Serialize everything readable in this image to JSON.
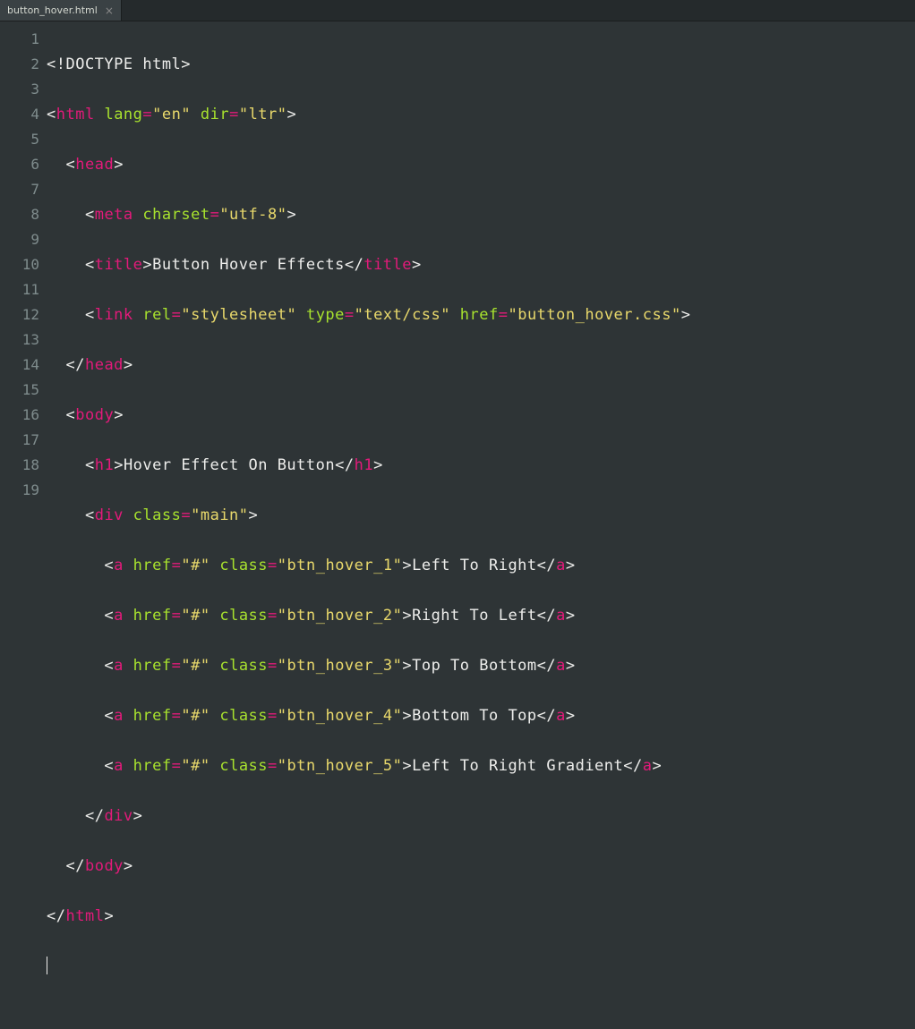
{
  "tab": {
    "title": "button_hover.html",
    "close": "×"
  },
  "gutter": [
    "1",
    "2",
    "3",
    "4",
    "5",
    "6",
    "7",
    "8",
    "9",
    "10",
    "11",
    "12",
    "13",
    "14",
    "15",
    "16",
    "17",
    "18",
    "19"
  ],
  "code": {
    "l1": {
      "doctype": "<!DOCTYPE html>"
    },
    "l2": {
      "o": "<",
      "tag": "html",
      "sp": " ",
      "a1": "lang",
      "eq": "=",
      "v1": "\"en\"",
      "sp2": " ",
      "a2": "dir",
      "v2": "\"ltr\"",
      "c": ">"
    },
    "l3": {
      "ind": "  ",
      "o": "<",
      "tag": "head",
      "c": ">"
    },
    "l4": {
      "ind": "    ",
      "o": "<",
      "tag": "meta",
      "sp": " ",
      "a1": "charset",
      "eq": "=",
      "v1": "\"utf-8\"",
      "c": ">"
    },
    "l5": {
      "ind": "    ",
      "o": "<",
      "tag": "title",
      "c": ">",
      "txt": "Button Hover Effects",
      "o2": "</",
      "c2": ">"
    },
    "l6": {
      "ind": "    ",
      "o": "<",
      "tag": "link",
      "sp": " ",
      "a1": "rel",
      "eq": "=",
      "v1": "\"stylesheet\"",
      "sp2": " ",
      "a2": "type",
      "v2": "\"text/css\"",
      "sp3": " ",
      "a3": "href",
      "v3": "\"button_hover.css\"",
      "c": ">"
    },
    "l7": {
      "ind": "  ",
      "o": "</",
      "tag": "head",
      "c": ">"
    },
    "l8": {
      "ind": "  ",
      "o": "<",
      "tag": "body",
      "c": ">"
    },
    "l9": {
      "ind": "    ",
      "o": "<",
      "tag": "h1",
      "c": ">",
      "txt": "Hover Effect On Button",
      "o2": "</",
      "c2": ">"
    },
    "l10": {
      "ind": "    ",
      "o": "<",
      "tag": "div",
      "sp": " ",
      "a1": "class",
      "eq": "=",
      "v1": "\"main\"",
      "c": ">"
    },
    "l11": {
      "ind": "      ",
      "o": "<",
      "tag": "a",
      "sp": " ",
      "a1": "href",
      "eq": "=",
      "v1": "\"#\"",
      "sp2": " ",
      "a2": "class",
      "v2": "\"btn_hover_1\"",
      "c": ">",
      "txt": "Left To Right",
      "o2": "</",
      "c2": ">"
    },
    "l12": {
      "ind": "      ",
      "o": "<",
      "tag": "a",
      "sp": " ",
      "a1": "href",
      "eq": "=",
      "v1": "\"#\"",
      "sp2": " ",
      "a2": "class",
      "v2": "\"btn_hover_2\"",
      "c": ">",
      "txt": "Right To Left",
      "o2": "</",
      "c2": ">"
    },
    "l13": {
      "ind": "      ",
      "o": "<",
      "tag": "a",
      "sp": " ",
      "a1": "href",
      "eq": "=",
      "v1": "\"#\"",
      "sp2": " ",
      "a2": "class",
      "v2": "\"btn_hover_3\"",
      "c": ">",
      "txt": "Top To Bottom",
      "o2": "</",
      "c2": ">"
    },
    "l14": {
      "ind": "      ",
      "o": "<",
      "tag": "a",
      "sp": " ",
      "a1": "href",
      "eq": "=",
      "v1": "\"#\"",
      "sp2": " ",
      "a2": "class",
      "v2": "\"btn_hover_4\"",
      "c": ">",
      "txt": "Bottom To Top",
      "o2": "</",
      "c2": ">"
    },
    "l15": {
      "ind": "      ",
      "o": "<",
      "tag": "a",
      "sp": " ",
      "a1": "href",
      "eq": "=",
      "v1": "\"#\"",
      "sp2": " ",
      "a2": "class",
      "v2": "\"btn_hover_5\"",
      "c": ">",
      "txt": "Left To Right Gradient",
      "o2": "</",
      "c2": ">"
    },
    "l16": {
      "ind": "    ",
      "o": "</",
      "tag": "div",
      "c": ">"
    },
    "l17": {
      "ind": "  ",
      "o": "</",
      "tag": "body",
      "c": ">"
    },
    "l18": {
      "o": "</",
      "tag": "html",
      "c": ">"
    }
  }
}
